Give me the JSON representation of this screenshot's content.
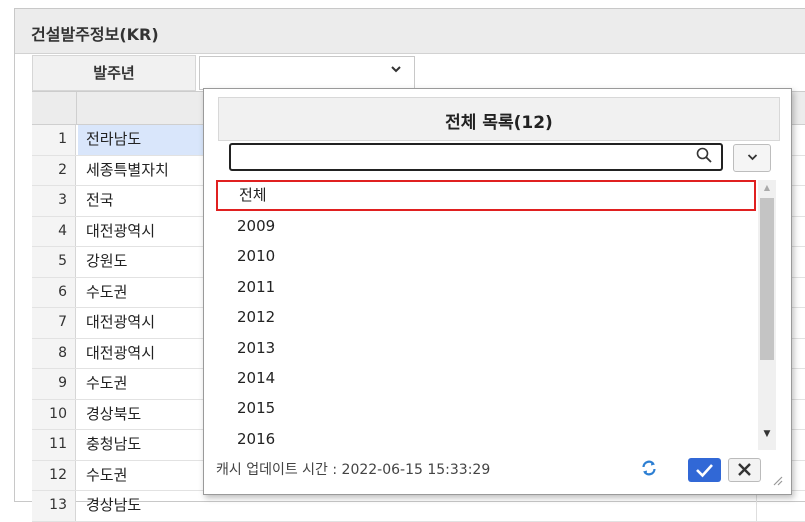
{
  "panel": {
    "title": "건설발주정보(KR)",
    "filter_label": "발주년",
    "filter_value": ""
  },
  "grid": {
    "rows": [
      {
        "num": "1",
        "region": "전라남도"
      },
      {
        "num": "2",
        "region": "세종특별자치"
      },
      {
        "num": "3",
        "region": "전국"
      },
      {
        "num": "4",
        "region": "대전광역시"
      },
      {
        "num": "5",
        "region": "강원도"
      },
      {
        "num": "6",
        "region": "수도권"
      },
      {
        "num": "7",
        "region": "대전광역시"
      },
      {
        "num": "8",
        "region": "대전광역시"
      },
      {
        "num": "9",
        "region": "수도권"
      },
      {
        "num": "10",
        "region": "경상북도"
      },
      {
        "num": "11",
        "region": "충청남도"
      },
      {
        "num": "12",
        "region": "수도권"
      },
      {
        "num": "13",
        "region": "경상남도"
      }
    ]
  },
  "popup": {
    "title": "전체 목록(12)",
    "search_value": "",
    "items": [
      "전체",
      "2009",
      "2010",
      "2011",
      "2012",
      "2013",
      "2014",
      "2015",
      "2016"
    ],
    "cache_text": "캐시 업데이트 시간 : 2022-06-15 15:33:29"
  },
  "colors": {
    "accent": "#3168d6",
    "highlight_border": "#e02020",
    "selected_row": "#d9e6fb",
    "refresh": "#2d7fd3"
  },
  "icons": {
    "search": "search-icon",
    "dropdown": "chevron-down-icon",
    "refresh": "refresh-icon",
    "confirm": "check-icon",
    "cancel": "close-icon"
  }
}
